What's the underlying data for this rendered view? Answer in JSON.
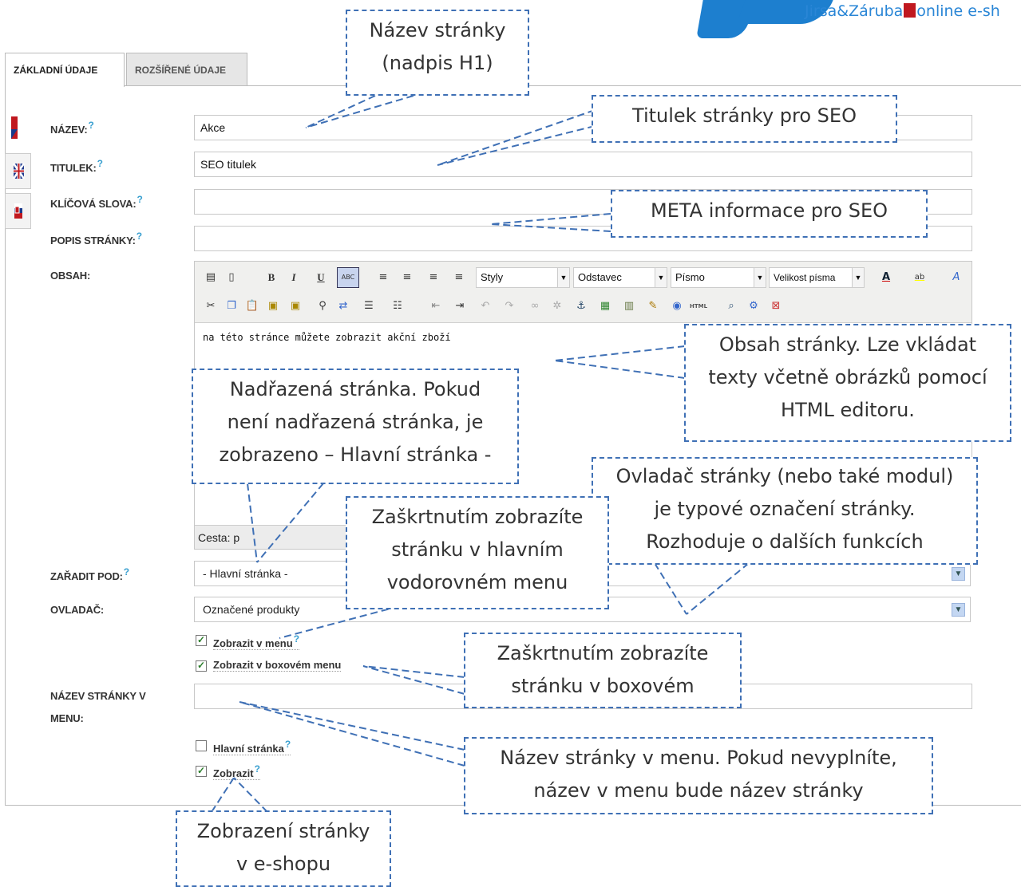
{
  "logo": {
    "text_left": "Jirsa&Záruba",
    "text_right": "online e-sh"
  },
  "tabs": [
    {
      "label": "ZÁKLADNÍ ÚDAJE"
    },
    {
      "label": "ROZŠÍŘENÉ ÚDAJE"
    }
  ],
  "form": {
    "nazev_label": "NÁZEV:",
    "nazev_value": "Akce",
    "titulek_label": "TITULEK:",
    "titulek_value": "SEO titulek",
    "klicova_label": "KLÍČOVÁ SLOVA:",
    "popis_label": "POPIS STRÁNKY:",
    "obsah_label": "OBSAH:",
    "zaradit_label": "ZAŘADIT POD:",
    "zaradit_value": "- Hlavní stránka -",
    "ovladac_label": "OVLADAČ:",
    "ovladac_value": "Označené produkty",
    "zobrazit_v_menu": "Zobrazit v menu",
    "zobrazit_v_boxovem": "Zobrazit v boxovém menu",
    "nazev_menu_label_1": "NÁZEV STRÁNKY V",
    "nazev_menu_label_2": "MENU:",
    "hlavni_stranka": "Hlavní stránka",
    "zobrazit": "Zobrazit",
    "help": "?"
  },
  "editor": {
    "styly": "Styly",
    "odstavec": "Odstavec",
    "pismo": "Písmo",
    "velikost": "Velikost písma",
    "content": "na této stránce můžete zobrazit akční zboží",
    "path": "Cesta: p"
  },
  "callouts": {
    "nazev_1": "Název stránky",
    "nazev_2": "(nadpis H1)",
    "titulek": "Titulek stránky pro SEO",
    "meta": "META informace pro SEO",
    "obsah_1": "Obsah stránky. Lze vkládat",
    "obsah_2": "texty včetně obrázků pomocí",
    "obsah_3": "HTML editoru.",
    "nadrazena_1": "Nadřazená stránka. Pokud",
    "nadrazena_2": "není nadřazená stránka, je",
    "nadrazena_3": "zobrazeno – Hlavní stránka -",
    "ovladac_1": "Ovladač stránky (nebo také modul)",
    "ovladac_2": "je typové označení stránky.",
    "ovladac_3": "Rozhoduje o dalších funkcích",
    "zaskrt_1": "Zaškrtnutím zobrazíte",
    "zaskrt_2": "stránku v hlavním",
    "zaskrt_3": "vodorovném menu",
    "box_1": "Zaškrtnutím zobrazíte",
    "box_2": "stránku v boxovém",
    "menu_1": "Název stránky v menu. Pokud nevyplníte,",
    "menu_2": "název v menu bude název stránky",
    "eshop_1": "Zobrazení stránky",
    "eshop_2": "v e-shopu"
  },
  "colors": {
    "callout_border": "#3f70b5",
    "logo_blue": "#1d7fcf",
    "logo_red": "#c0181f"
  }
}
